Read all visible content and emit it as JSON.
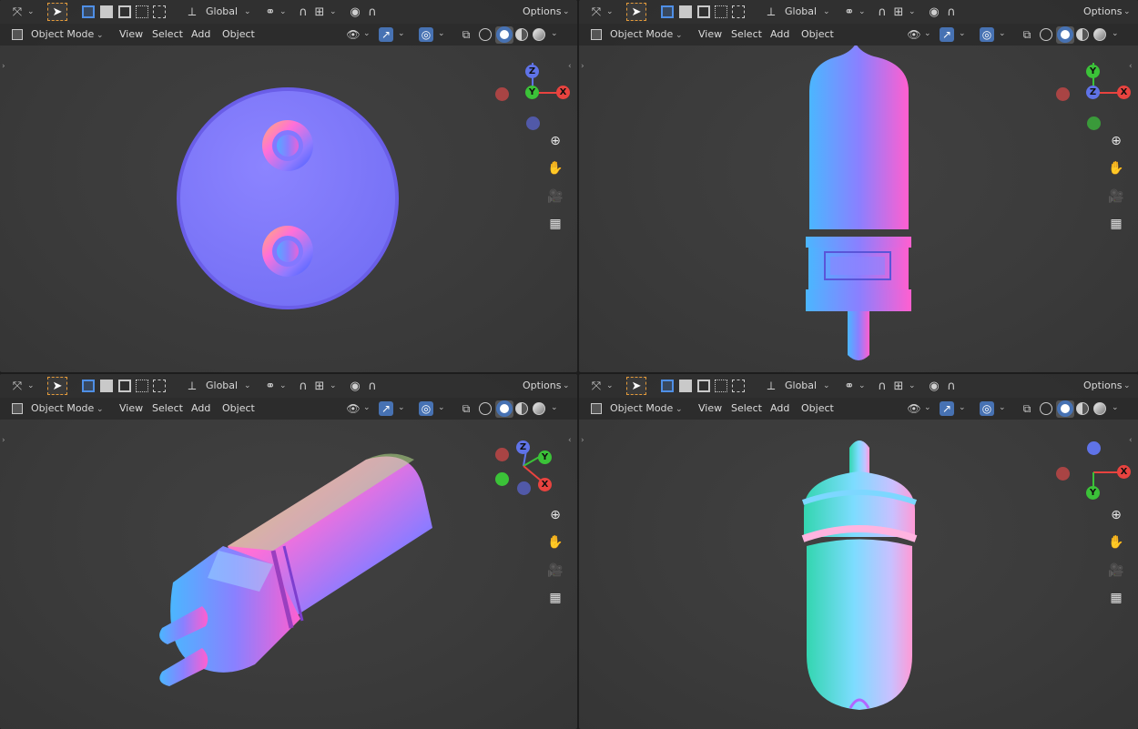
{
  "toolbar": {
    "transform_orientation": "Global",
    "options_label": "Options"
  },
  "header": {
    "mode_label": "Object Mode",
    "menu": [
      "View",
      "Select",
      "Add",
      "Object"
    ]
  },
  "viewports": [
    {
      "id": "top-left",
      "view": "front-orthographic",
      "object": "round cap with two pins",
      "gizmo_axes": [
        "Z",
        "Y",
        "X"
      ]
    },
    {
      "id": "top-right",
      "view": "right-orthographic",
      "object": "tube with base and single pin",
      "gizmo_axes": [
        "Y",
        "Z",
        "X"
      ]
    },
    {
      "id": "bottom-left",
      "view": "user-perspective",
      "object": "tilted capsule with two pins",
      "gizmo_axes": [
        "Z",
        "Y",
        "X"
      ]
    },
    {
      "id": "bottom-right",
      "view": "top-orthographic",
      "object": "capsule with rings and nub",
      "gizmo_axes": [
        "X",
        "Y"
      ]
    }
  ],
  "colors": {
    "accent_blue": "#4772b3",
    "selection_orange": "#e49b3a",
    "axis_x": "#e8433f",
    "axis_y": "#3bc238",
    "axis_z": "#5f73e8",
    "viewport_bg": "#3c3c3c",
    "header_bg": "#2b2b2b"
  },
  "icons": {
    "nav": [
      "zoom-icon",
      "hand-pan-icon",
      "camera-icon",
      "grid-icon"
    ]
  }
}
